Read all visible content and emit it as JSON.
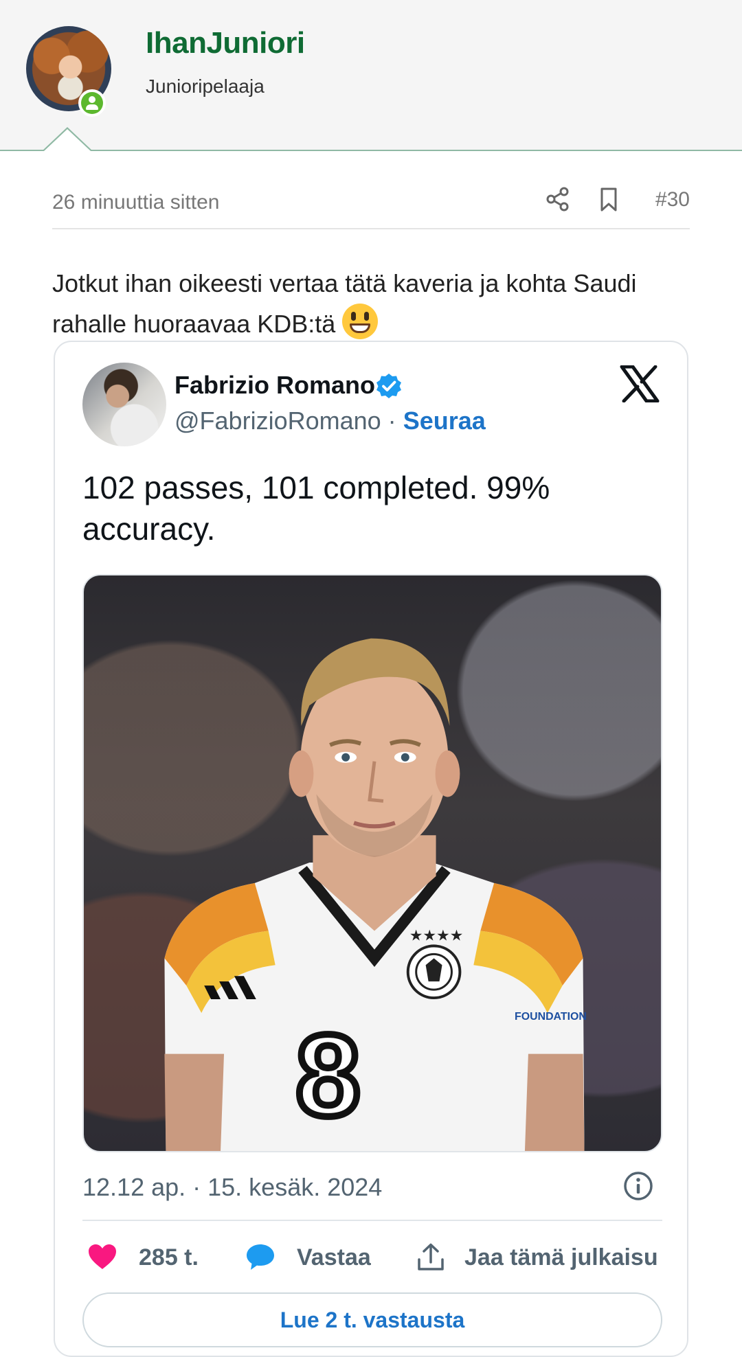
{
  "author": {
    "username": "IhanJuniori",
    "rank": "Junioripelaaja",
    "status": "online"
  },
  "post": {
    "time": "26 minuuttia sitten",
    "number": "#30",
    "text": "Jotkut ihan oikeesti vertaa tätä kaveria ja kohta Saudi rahalle huoraavaa KDB:tä",
    "emoji": "grinning-face"
  },
  "tweet": {
    "name": "Fabrizio Romano",
    "handle": "@FabrizioRomano",
    "separator": "·",
    "follow_label": "Seuraa",
    "text": "102 passes, 101 completed. 99% accuracy.",
    "date": "12.12 ap. · 15. kesäk. 2024",
    "likes": "285 t.",
    "reply_label": "Vastaa",
    "share_label": "Jaa tämä julkaisu",
    "read_replies_label": "Lue 2 t. vastausta",
    "jersey_number": "8",
    "jersey_badge": "FOUNDATION"
  },
  "colors": {
    "username": "#0f6b34",
    "link": "#1d74c8",
    "like": "#f91880",
    "reply": "#1d9bf0",
    "online": "#5cb82e",
    "verified": "#1d9bf0"
  }
}
